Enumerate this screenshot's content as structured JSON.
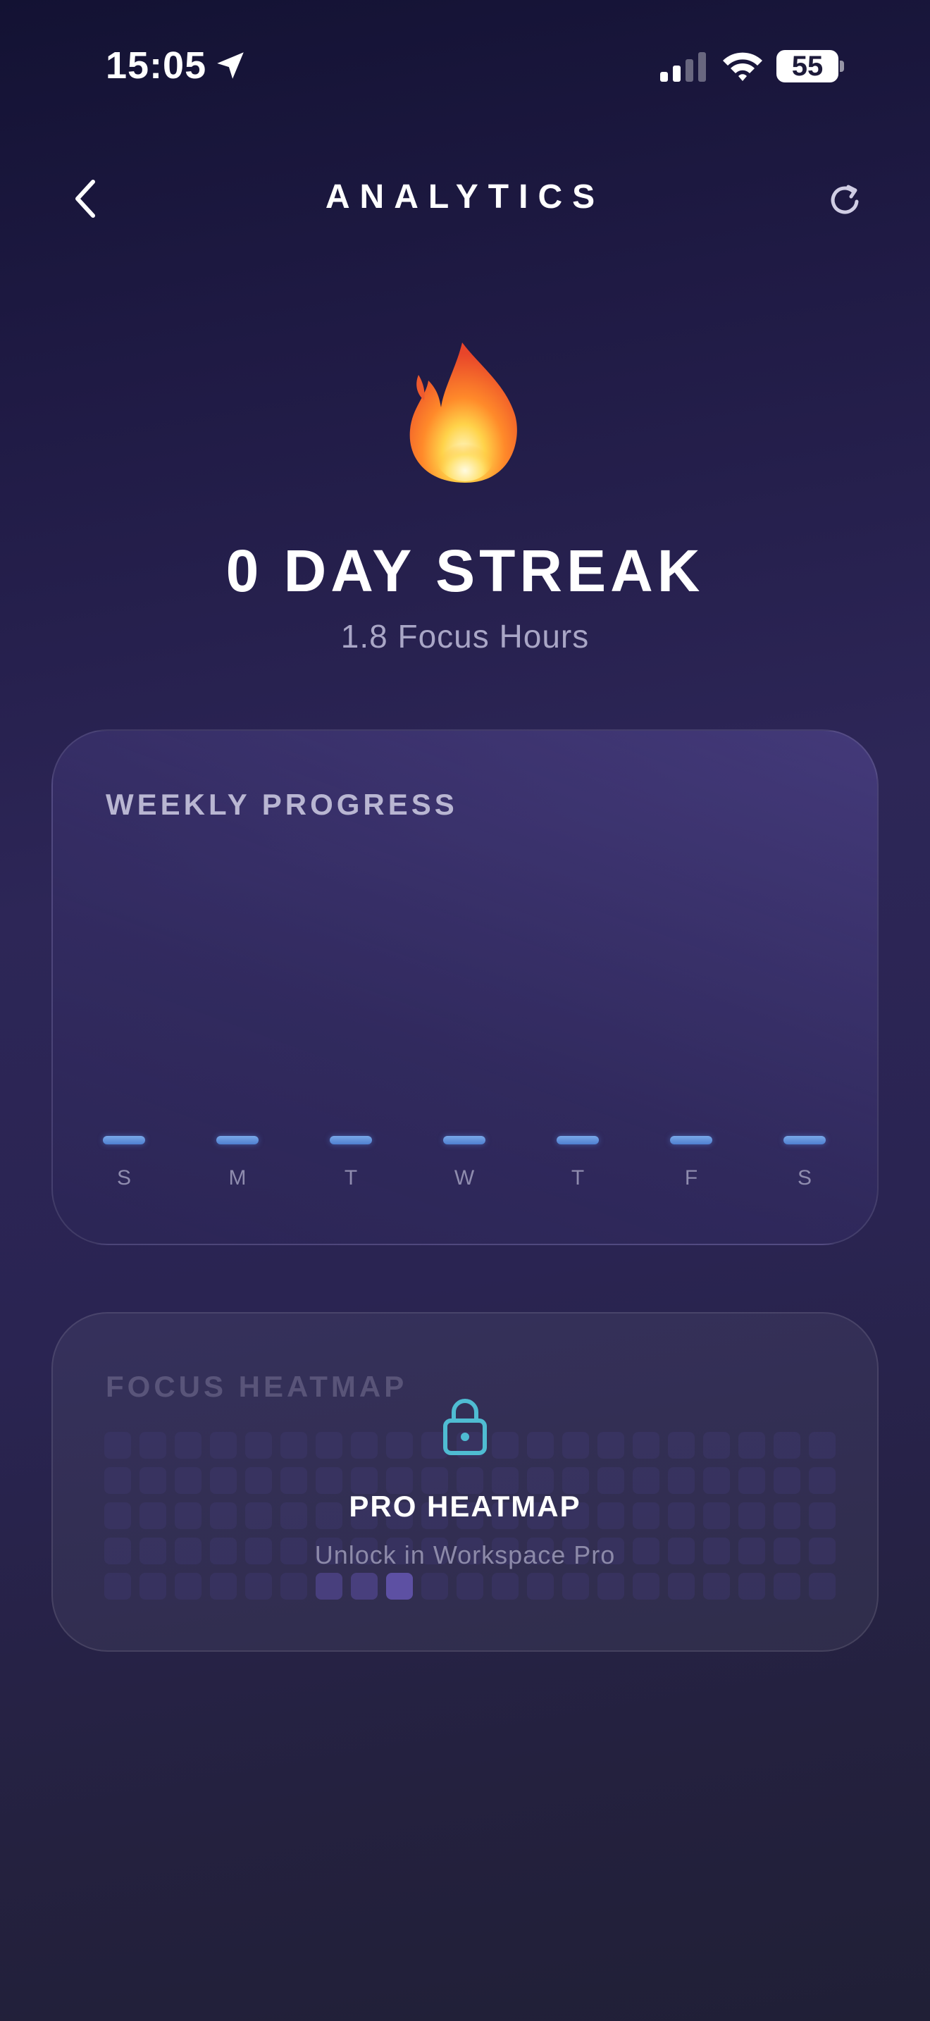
{
  "status_bar": {
    "time": "15:05",
    "battery": "55"
  },
  "header": {
    "title": "ANALYTICS"
  },
  "streak": {
    "title": "0 DAY STREAK",
    "subtitle": "1.8 Focus Hours"
  },
  "weekly": {
    "title": "WEEKLY PROGRESS",
    "days": [
      "S",
      "M",
      "T",
      "W",
      "T",
      "F",
      "S"
    ]
  },
  "chart_data": {
    "type": "bar",
    "title": "WEEKLY PROGRESS",
    "categories": [
      "S",
      "M",
      "T",
      "W",
      "T",
      "F",
      "S"
    ],
    "values": [
      0,
      0,
      0,
      0,
      0,
      0,
      0
    ]
  },
  "heatmap": {
    "title": "FOCUS HEATMAP",
    "lock_title": "PRO HEATMAP",
    "lock_subtitle": "Unlock in Workspace Pro"
  },
  "colors": {
    "accent_bar": "#5f8fdc",
    "lock": "#4fbcd2"
  },
  "icons": {
    "location": "location-arrow-icon",
    "signal": "cellular-signal-icon",
    "wifi": "wifi-icon",
    "battery": "battery-icon",
    "back": "chevron-left-icon",
    "refresh": "refresh-icon",
    "flame": "flame-icon",
    "lock": "lock-icon"
  }
}
